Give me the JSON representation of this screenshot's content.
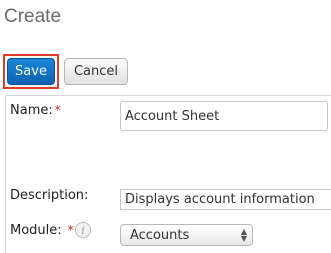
{
  "page": {
    "title": "Create"
  },
  "toolbar": {
    "save_label": "Save",
    "cancel_label": "Cancel",
    "highlight_color": "#e03c28",
    "save_color": "#1473c7"
  },
  "form": {
    "name": {
      "label": "Name:",
      "required_mark": "*",
      "value": "Account Sheet"
    },
    "description": {
      "label": "Description:",
      "value": "Displays account information"
    },
    "module": {
      "label": "Module:",
      "required_mark": "*",
      "info_icon": "info-icon",
      "info_glyph": "i",
      "selected": "Accounts"
    }
  }
}
